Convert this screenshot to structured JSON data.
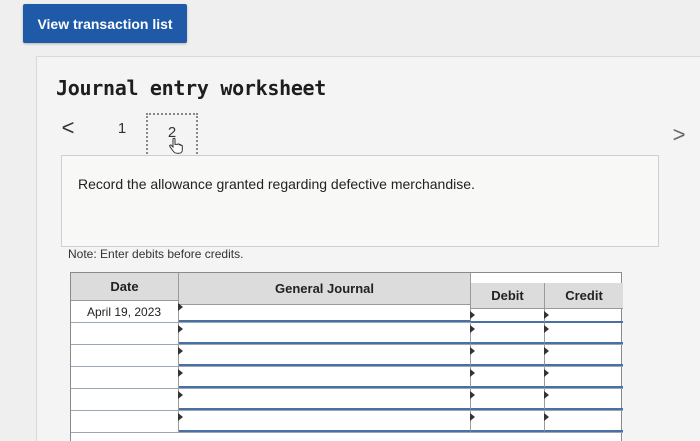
{
  "header": {
    "view_transactions_label": "View transaction list"
  },
  "worksheet": {
    "title": "Journal entry worksheet",
    "nav": {
      "prev_glyph": "<",
      "next_glyph": ">",
      "steps": [
        "1",
        "2"
      ],
      "current_step": 2
    },
    "instruction": "Record the allowance granted regarding defective merchandise.",
    "note": "Note: Enter debits before credits."
  },
  "journal": {
    "columns": {
      "date": "Date",
      "general_journal": "General Journal",
      "debit": "Debit",
      "credit": "Credit"
    },
    "rows": [
      {
        "date": "April 19, 2023",
        "account": "",
        "debit": "",
        "credit": ""
      },
      {
        "date": "",
        "account": "",
        "debit": "",
        "credit": ""
      },
      {
        "date": "",
        "account": "",
        "debit": "",
        "credit": ""
      },
      {
        "date": "",
        "account": "",
        "debit": "",
        "credit": ""
      },
      {
        "date": "",
        "account": "",
        "debit": "",
        "credit": ""
      },
      {
        "date": "",
        "account": "",
        "debit": "",
        "credit": ""
      }
    ]
  },
  "colors": {
    "button_blue": "#1f5aa8",
    "header_gray": "#dcdcdc",
    "input_underline": "#4a6fa3"
  },
  "icons": {
    "pointer": "hand-pointer-icon",
    "prev": "chevron-left-icon",
    "next": "chevron-right-icon"
  }
}
